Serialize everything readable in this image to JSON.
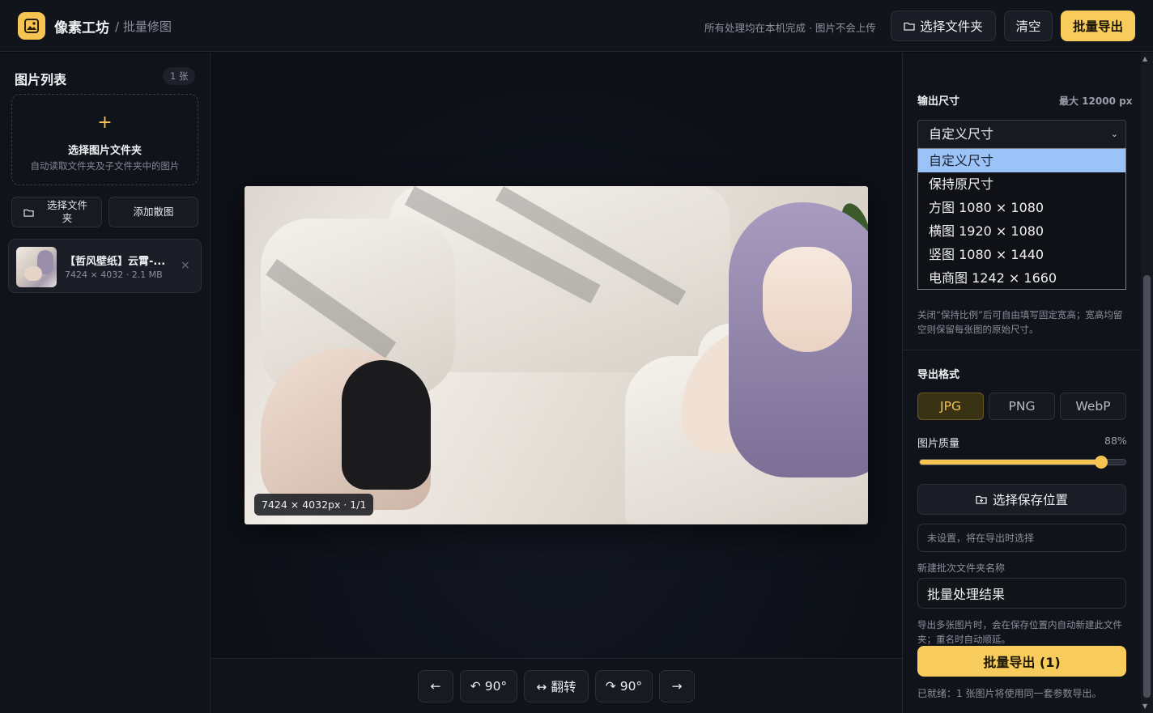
{
  "header": {
    "app_name": "像素工坊",
    "breadcrumb": "/ 批量修图",
    "privacy_note": "所有处理均在本机完成 · 图片不会上传",
    "choose_folder_label": "选择文件夹",
    "clear_label": "清空",
    "batch_export_label": "批量导出"
  },
  "sidebar": {
    "title": "图片列表",
    "count": "1 张",
    "dropzone": {
      "plus": "+",
      "title": "选择图片文件夹",
      "subtitle": "自动读取文件夹及子文件夹中的图片"
    },
    "choose_folder_label": "选择文件夹",
    "add_images_label": "添加散图",
    "files": [
      {
        "name": "【哲风壁纸】云霄-...",
        "meta": "7424 × 4032 · 2.1 MB",
        "close": "×"
      }
    ]
  },
  "preview": {
    "badge": "7424 × 4032px · 1/1"
  },
  "toolbar": {
    "prev": "←",
    "rotate_left": "↶ 90°",
    "flip": "↔ 翻转",
    "rotate_right": "↷ 90°",
    "next": "→"
  },
  "settings": {
    "output_size": {
      "label": "输出尺寸",
      "max_note": "最大 12000 px",
      "selected": "自定义尺寸",
      "options": [
        "自定义尺寸",
        "保持原尺寸",
        "方图 1080 × 1080",
        "横图 1920 × 1080",
        "竖图 1080 × 1440",
        "电商图 1242 × 1660"
      ],
      "hint": "关闭“保持比例”后可自由填写固定宽高；宽高均留空则保留每张图的原始尺寸。"
    },
    "export_format": {
      "label": "导出格式",
      "formats": [
        "JPG",
        "PNG",
        "WebP"
      ],
      "active": "JPG"
    },
    "quality": {
      "label": "图片质量",
      "value_text": "88%",
      "value": 0.88
    },
    "save_location": {
      "button_label": "选择保存位置",
      "placeholder": "未设置，将在导出时选择"
    },
    "batch_folder": {
      "label": "新建批次文件夹名称",
      "value": "批量处理结果",
      "hint": "导出多张图片时，会在保存位置内自动新建此文件夹；重名时自动顺延。"
    },
    "export_button": "批量导出 (1)",
    "status": "已就绪：1 张图片将使用同一套参数导出。"
  },
  "colors": {
    "accent": "#f8cc5c",
    "background": "#0b0d13",
    "panel": "#11131a",
    "option_highlight": "#9cc3f7"
  }
}
